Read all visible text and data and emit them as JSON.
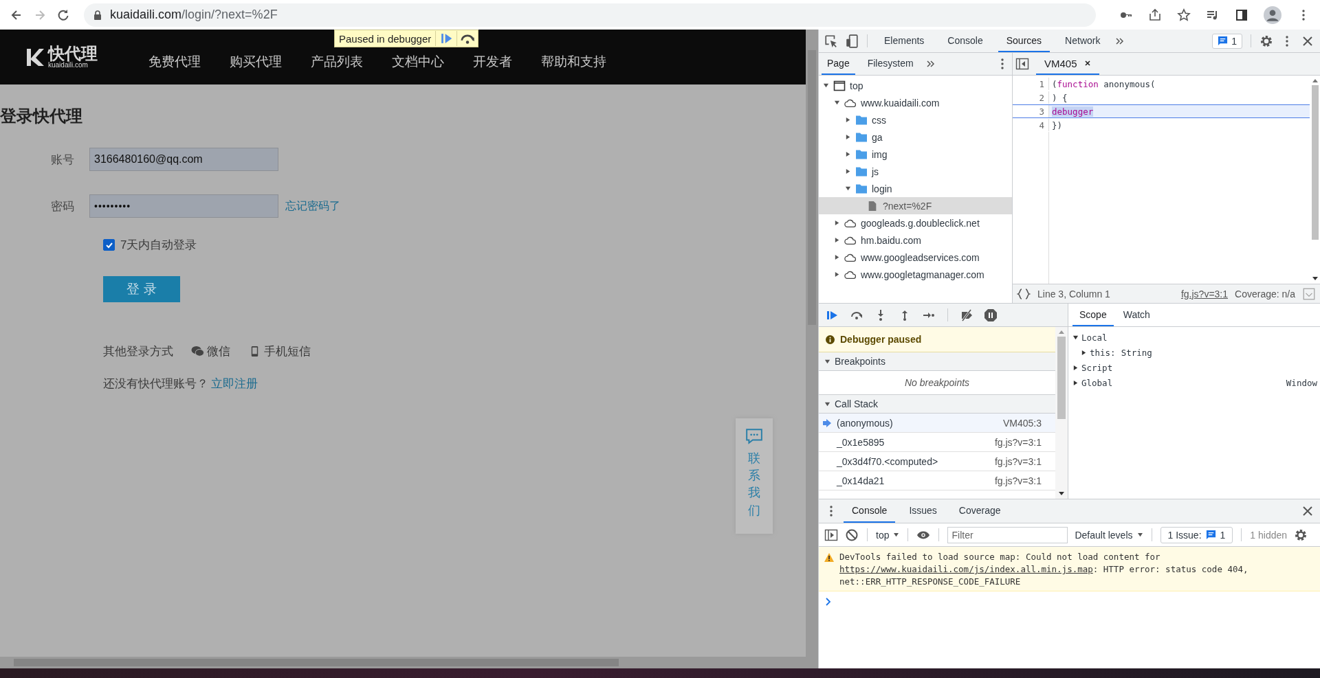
{
  "browser": {
    "url_host": "kuaidaili.com",
    "url_path": "/login/?next=%2F"
  },
  "site": {
    "logo_text": "快代理",
    "logo_domain": "kuaidaili.com",
    "nav": [
      "免费代理",
      "购买代理",
      "产品列表",
      "文档中心",
      "开发者",
      "帮助和支持"
    ],
    "paused_banner": "Paused in debugger"
  },
  "login": {
    "title": "登录快代理",
    "fields": [
      {
        "label": "账号",
        "value": "3166480160@qq.com",
        "kind": "text"
      },
      {
        "label": "密码",
        "value": "•••••••••",
        "kind": "password",
        "link": "忘记密码了"
      }
    ],
    "remember": {
      "label": "7天内自动登录",
      "checked": true
    },
    "submit": "登 录",
    "other_login": {
      "label": "其他登录方式",
      "methods": [
        {
          "label": "微信",
          "kind": "wechat"
        },
        {
          "label": "手机短信",
          "kind": "phone"
        }
      ]
    },
    "register": {
      "prompt": "还没有快代理账号？",
      "link": "立即注册"
    }
  },
  "contact_widget": {
    "label": "联系我们"
  },
  "devtools": {
    "tabs": [
      {
        "label": "Elements",
        "selected": false
      },
      {
        "label": "Console",
        "selected": false
      },
      {
        "label": "Sources",
        "selected": true
      },
      {
        "label": "Network",
        "selected": false
      }
    ],
    "issues_count": "1",
    "sources": {
      "nav_tabs": [
        {
          "label": "Page",
          "selected": true
        },
        {
          "label": "Filesystem",
          "selected": false
        }
      ],
      "tree": [
        {
          "label": "top",
          "kind": "frame",
          "expanded": true,
          "selected": false,
          "children": [
            {
              "label": "www.kuaidaili.com",
              "kind": "domain",
              "expanded": true,
              "selected": false,
              "children": [
                {
                  "label": "css",
                  "kind": "folder",
                  "expanded": false,
                  "selected": false
                },
                {
                  "label": "ga",
                  "kind": "folder",
                  "expanded": false,
                  "selected": false
                },
                {
                  "label": "img",
                  "kind": "folder",
                  "expanded": false,
                  "selected": false
                },
                {
                  "label": "js",
                  "kind": "folder",
                  "expanded": false,
                  "selected": false
                },
                {
                  "label": "login",
                  "kind": "folder",
                  "expanded": true,
                  "selected": false,
                  "children": [
                    {
                      "label": "?next=%2F",
                      "kind": "file",
                      "selected": true
                    }
                  ]
                }
              ]
            },
            {
              "label": "googleads.g.doubleclick.net",
              "kind": "domain",
              "expanded": false,
              "selected": false
            },
            {
              "label": "hm.baidu.com",
              "kind": "domain",
              "expanded": false,
              "selected": false
            },
            {
              "label": "www.googleadservices.com",
              "kind": "domain",
              "expanded": false,
              "selected": false
            },
            {
              "label": "www.googletagmanager.com",
              "kind": "domain",
              "expanded": false,
              "selected": false
            }
          ]
        }
      ],
      "editor_tab": "VM405",
      "code": [
        {
          "number": "1",
          "current": false,
          "tokens": [
            {
              "text": "(",
              "kind": "plain"
            },
            {
              "text": "function",
              "kind": "keyword"
            },
            {
              "text": " anonymous(",
              "kind": "plain"
            }
          ]
        },
        {
          "number": "2",
          "current": false,
          "tokens": [
            {
              "text": ") {",
              "kind": "plain"
            }
          ]
        },
        {
          "number": "3",
          "current": true,
          "tokens": [
            {
              "text": "debugger",
              "kind": "keyword"
            }
          ]
        },
        {
          "number": "4",
          "current": false,
          "tokens": [
            {
              "text": "})",
              "kind": "plain"
            }
          ]
        }
      ],
      "status": {
        "position": "Line 3, Column 1",
        "source_link": "fg.js?v=3:1",
        "coverage": "Coverage: n/a"
      }
    },
    "debugger": {
      "paused_message": "Debugger paused",
      "breakpoints": {
        "title": "Breakpoints",
        "expanded": true,
        "empty_text": "No breakpoints"
      },
      "call_stack": {
        "title": "Call Stack",
        "expanded": true,
        "frames": [
          {
            "name": "(anonymous)",
            "location": "VM405:3",
            "current": true
          },
          {
            "name": "_0x1e5895",
            "location": "fg.js?v=3:1",
            "current": false
          },
          {
            "name": "_0x3d4f70.<computed>",
            "location": "fg.js?v=3:1",
            "current": false
          },
          {
            "name": "_0x14da21",
            "location": "fg.js?v=3:1",
            "current": false
          }
        ]
      },
      "scope_tabs": [
        {
          "label": "Scope",
          "selected": true
        },
        {
          "label": "Watch",
          "selected": false
        }
      ],
      "scope": [
        {
          "name": "Local",
          "expanded": true,
          "children": [
            {
              "name": "this:",
              "value": "String",
              "expanded": false
            }
          ]
        },
        {
          "name": "Script",
          "expanded": false
        },
        {
          "name": "Global",
          "expanded": false,
          "value": "Window"
        }
      ]
    }
  },
  "drawer": {
    "tabs": [
      {
        "label": "Console",
        "selected": true
      },
      {
        "label": "Issues",
        "selected": false
      },
      {
        "label": "Coverage",
        "selected": false
      }
    ],
    "context": "top",
    "filter_placeholder": "Filter",
    "levels": "Default levels",
    "issues_label": "1 Issue:",
    "issues_count": "1",
    "hidden": "1 hidden",
    "messages": [
      {
        "kind": "warning",
        "text_before": "DevTools failed to load source map: Could not load content for ",
        "link": "https://www.kuaidaili.com/js/index.all.min.js.map",
        "text_after": ": HTTP error: status code 404, net::ERR_HTTP_RESPONSE_CODE_FAILURE"
      }
    ]
  }
}
